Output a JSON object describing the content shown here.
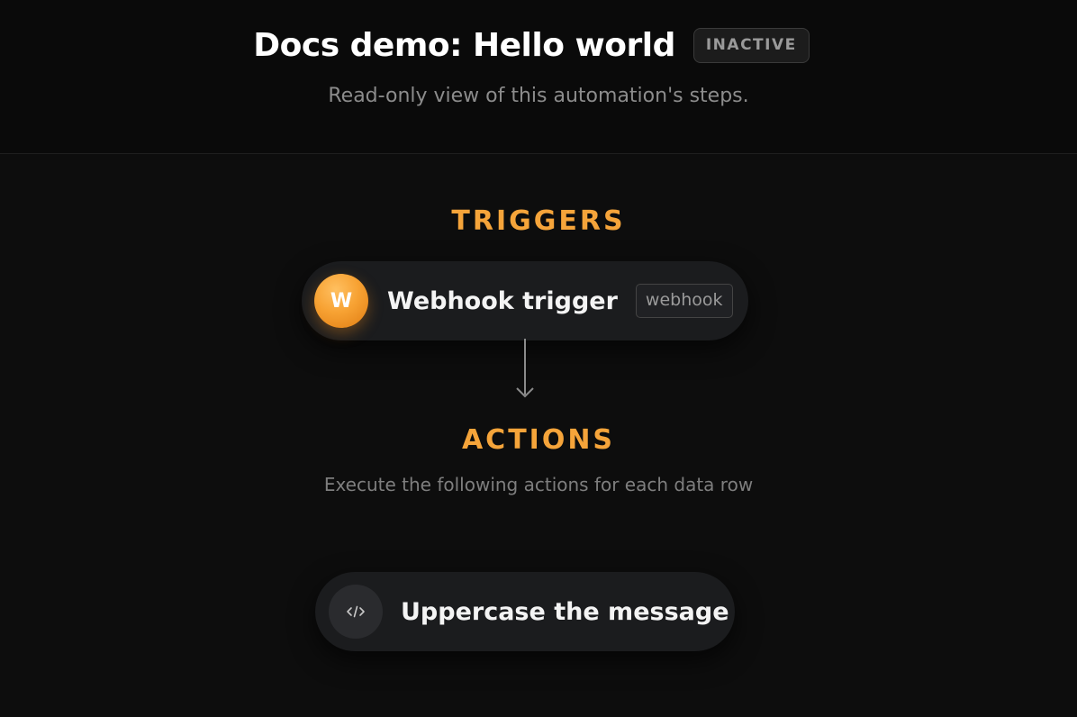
{
  "header": {
    "title": "Docs demo: Hello world",
    "status": "INACTIVE",
    "subtitle": "Read-only view of this automation's steps."
  },
  "triggers": {
    "label": "TRIGGERS",
    "items": [
      {
        "avatar_letter": "W",
        "title": "Webhook trigger",
        "type": "webhook"
      }
    ]
  },
  "actions": {
    "label": "ACTIONS",
    "description": "Execute the following actions for each data row",
    "items": [
      {
        "icon": "code-icon",
        "title": "Uppercase the message"
      }
    ]
  },
  "colors": {
    "accent": "#f5a43a",
    "background": "#0d0d0d",
    "node_background": "#1b1c1e"
  }
}
